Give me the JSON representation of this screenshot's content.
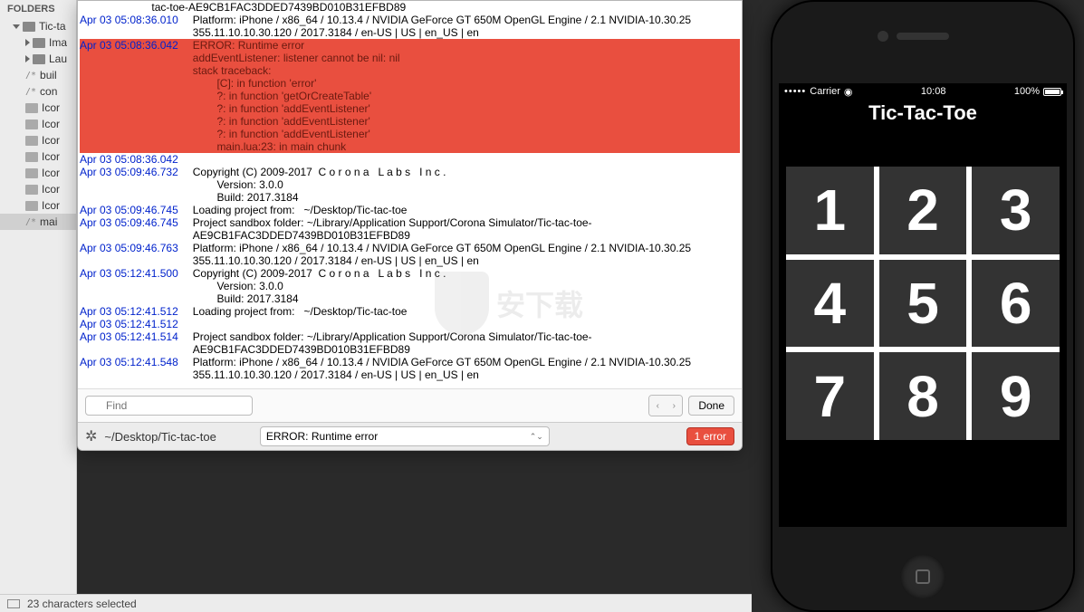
{
  "sidebar": {
    "header": "FOLDERS",
    "items": [
      {
        "label": "Tic-ta",
        "icon": "folder",
        "expand": "down",
        "indent": 1
      },
      {
        "label": "Ima",
        "icon": "folder",
        "expand": "right",
        "indent": 2
      },
      {
        "label": "Lau",
        "icon": "folder",
        "expand": "right",
        "indent": 2
      },
      {
        "label": "buil",
        "icon": "file",
        "indent": 2
      },
      {
        "label": "con",
        "icon": "file",
        "indent": 2
      },
      {
        "label": "Icor",
        "icon": "img",
        "indent": 2
      },
      {
        "label": "Icor",
        "icon": "img",
        "indent": 2
      },
      {
        "label": "Icor",
        "icon": "img",
        "indent": 2
      },
      {
        "label": "Icor",
        "icon": "img",
        "indent": 2
      },
      {
        "label": "Icor",
        "icon": "img",
        "indent": 2
      },
      {
        "label": "Icor",
        "icon": "img",
        "indent": 2
      },
      {
        "label": "Icor",
        "icon": "img",
        "indent": 2
      },
      {
        "label": "mai",
        "icon": "file",
        "indent": 2,
        "selected": true
      }
    ]
  },
  "log": [
    {
      "ts": "",
      "msg": "tac-toe-AE9CB1FAC3DDED7439BD010B31EFBD89"
    },
    {
      "ts": "Apr 03 05:08:36.010",
      "msg": "Platform: iPhone / x86_64 / 10.13.4 / NVIDIA GeForce GT 650M OpenGL Engine / 2.1 NVIDIA-10.30.25 355.11.10.10.30.120 / 2017.3184 / en-US | US | en_US | en"
    },
    {
      "ts": "Apr 03 05:08:36.042",
      "msg": "ERROR: Runtime error\naddEventListener: listener cannot be nil: nil\nstack traceback:\n        [C]: in function 'error'\n        ?: in function 'getOrCreateTable'\n        ?: in function 'addEventListener'\n        ?: in function 'addEventListener'\n        ?: in function 'addEventListener'\n        main.lua:23: in main chunk",
      "err": true
    },
    {
      "ts": "Apr 03 05:08:36.042",
      "msg": ""
    },
    {
      "ts": "Apr 03 05:09:46.732",
      "msg": "Copyright (C) 2009-2017  C o r o n a   L a b s   I n c .\n        Version: 3.0.0\n        Build: 2017.3184"
    },
    {
      "ts": "Apr 03 05:09:46.745",
      "msg": "Loading project from:   ~/Desktop/Tic-tac-toe"
    },
    {
      "ts": "Apr 03 05:09:46.745",
      "msg": "Project sandbox folder: ~/Library/Application Support/Corona Simulator/Tic-tac-toe-AE9CB1FAC3DDED7439BD010B31EFBD89"
    },
    {
      "ts": "Apr 03 05:09:46.763",
      "msg": "Platform: iPhone / x86_64 / 10.13.4 / NVIDIA GeForce GT 650M OpenGL Engine / 2.1 NVIDIA-10.30.25 355.11.10.10.30.120 / 2017.3184 / en-US | US | en_US | en"
    },
    {
      "ts": "Apr 03 05:12:41.500",
      "msg": "Copyright (C) 2009-2017  C o r o n a   L a b s   I n c .\n        Version: 3.0.0\n        Build: 2017.3184"
    },
    {
      "ts": "Apr 03 05:12:41.512",
      "msg": "Loading project from:   ~/Desktop/Tic-tac-toe"
    },
    {
      "ts": "Apr 03 05:12:41.512",
      "msg": ""
    },
    {
      "ts": "Apr 03 05:12:41.514",
      "msg": "Project sandbox folder: ~/Library/Application Support/Corona Simulator/Tic-tac-toe-AE9CB1FAC3DDED7439BD010B31EFBD89"
    },
    {
      "ts": "Apr 03 05:12:41.548",
      "msg": "Platform: iPhone / x86_64 / 10.13.4 / NVIDIA GeForce GT 650M OpenGL Engine / 2.1 NVIDIA-10.30.25 355.11.10.10.30.120 / 2017.3184 / en-US | US | en_US | en"
    }
  ],
  "find": {
    "placeholder": "Find",
    "done": "Done"
  },
  "status": {
    "path": "~/Desktop/Tic-tac-toe",
    "error_select": "ERROR: Runtime error",
    "error_count": "1 error"
  },
  "editor_bar": {
    "selection": "23 characters selected"
  },
  "phone": {
    "carrier": "Carrier",
    "time": "10:08",
    "battery": "100%",
    "title": "Tic-Tac-Toe",
    "cells": [
      "1",
      "2",
      "3",
      "4",
      "5",
      "6",
      "7",
      "8",
      "9"
    ]
  },
  "watermark": "安下载"
}
